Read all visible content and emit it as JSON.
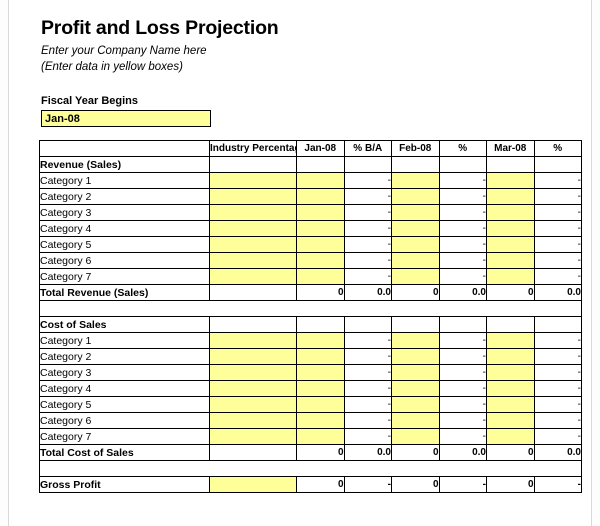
{
  "document": {
    "title": "Profit and Loss Projection",
    "subtitle_1": "Enter your Company Name here",
    "subtitle_2": "(Enter data in yellow boxes)"
  },
  "fiscal_year": {
    "label": "Fiscal Year Begins",
    "value": "Jan-08",
    "input_color": "#FFFF99"
  },
  "table": {
    "headers": {
      "label_col": "",
      "industry": "Industry Percentages",
      "month_1": "Jan-08",
      "pct_1": "% B/A",
      "month_2": "Feb-08",
      "pct_2": "%",
      "month_3": "Mar-08",
      "pct_3": "%"
    },
    "dash": "-",
    "sections": [
      {
        "title": "Revenue (Sales)",
        "rows": [
          {
            "label": "Category 1"
          },
          {
            "label": "Category 2"
          },
          {
            "label": "Category 3"
          },
          {
            "label": "Category 4"
          },
          {
            "label": "Category 5"
          },
          {
            "label": "Category 6"
          },
          {
            "label": "Category 7"
          }
        ],
        "total": {
          "label": "Total Revenue (Sales)",
          "industry": "",
          "month_1": "0",
          "pct_1": "0.0",
          "month_2": "0",
          "pct_2": "0.0",
          "month_3": "0",
          "pct_3": "0.0"
        }
      },
      {
        "title": "Cost of Sales",
        "rows": [
          {
            "label": "Category 1"
          },
          {
            "label": "Category 2"
          },
          {
            "label": "Category 3"
          },
          {
            "label": "Category 4"
          },
          {
            "label": "Category 5"
          },
          {
            "label": "Category 6"
          },
          {
            "label": "Category 7"
          }
        ],
        "total": {
          "label": "Total Cost of Sales",
          "industry": "",
          "month_1": "0",
          "pct_1": "0.0",
          "month_2": "0",
          "pct_2": "0.0",
          "month_3": "0",
          "pct_3": "0.0"
        }
      }
    ],
    "gross_profit": {
      "label": "Gross Profit",
      "industry": "",
      "month_1": "0",
      "pct_1": "-",
      "month_2": "0",
      "pct_2": "-",
      "month_3": "0",
      "pct_3": "-"
    }
  }
}
